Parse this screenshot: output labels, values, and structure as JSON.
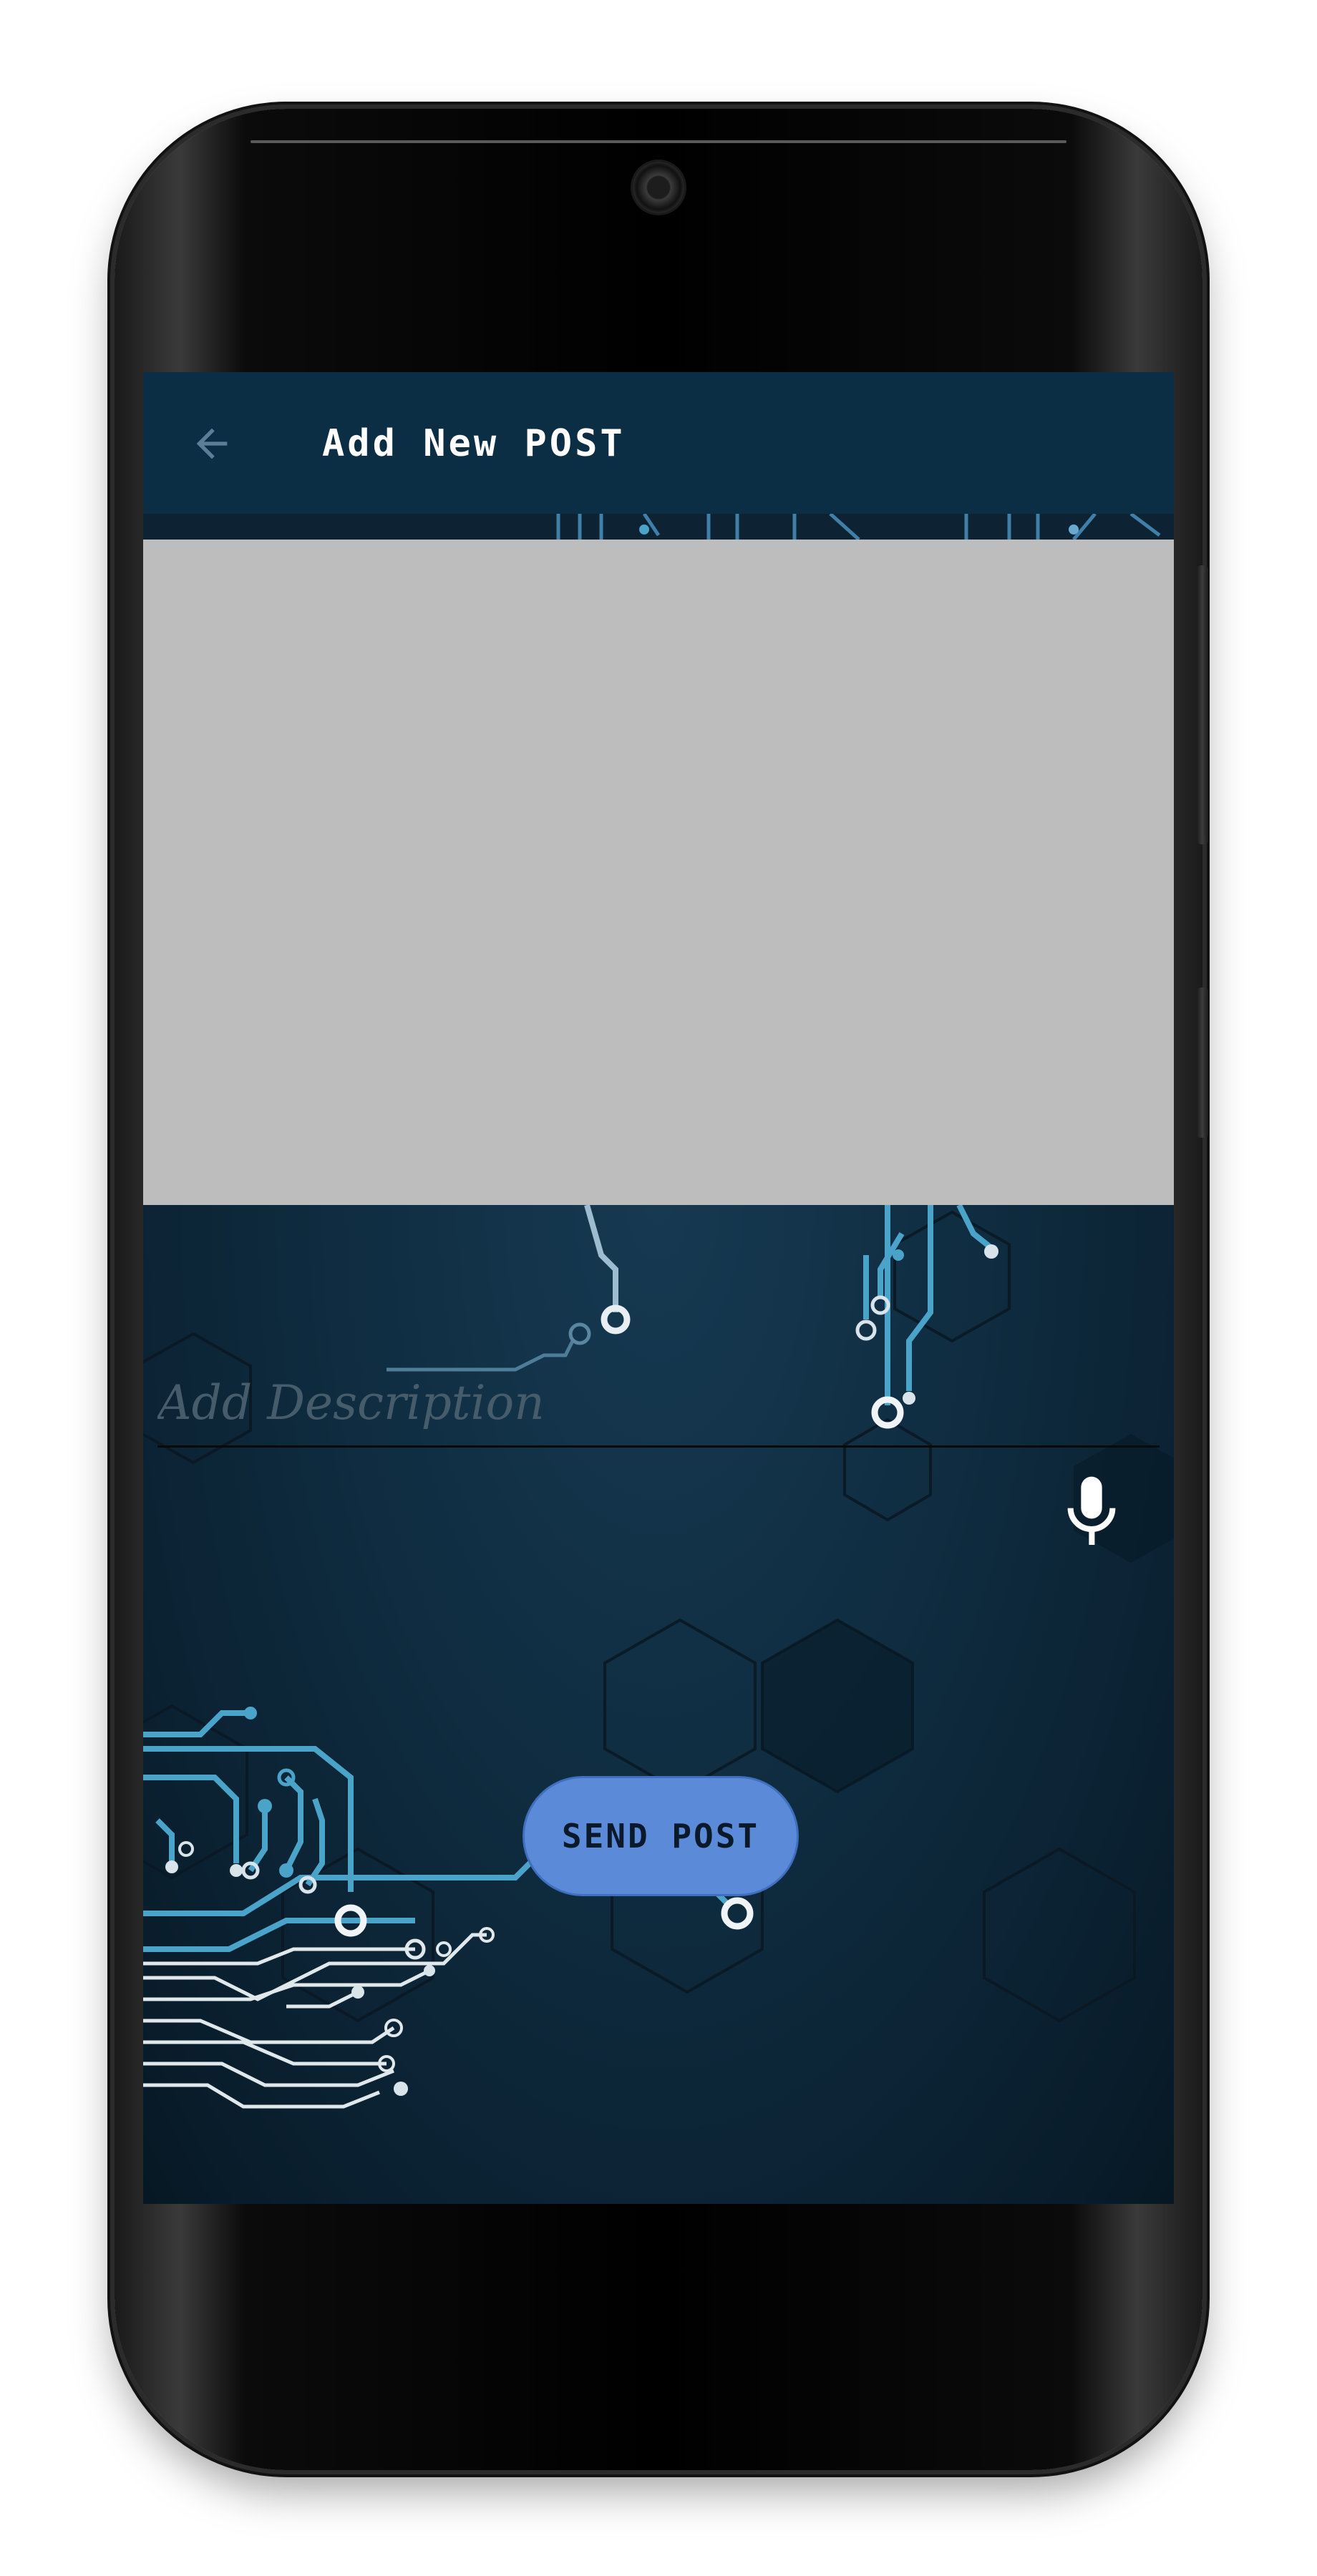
{
  "appbar": {
    "title": "Add New POST",
    "back_icon": "arrow-left-icon"
  },
  "post_form": {
    "description_placeholder": "Add Description",
    "mic_icon": "microphone-icon",
    "send_label": "SEND POST"
  },
  "colors": {
    "appbar": "#0c2e45",
    "send_button": "#5b8ad8",
    "image_placeholder": "#bdbdbd",
    "circuit_accent": "#4aa3c8"
  }
}
